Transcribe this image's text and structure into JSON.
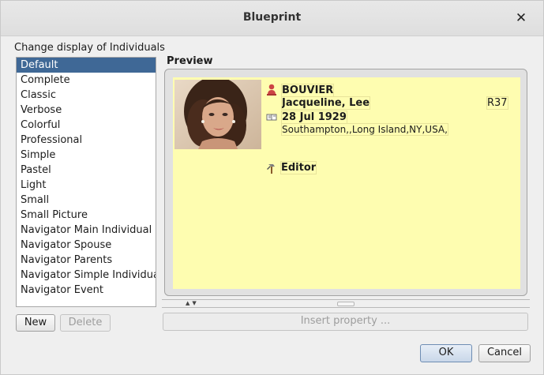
{
  "window": {
    "title": "Blueprint"
  },
  "left": {
    "label": "Change display of Individuals",
    "items": [
      "Default",
      "Complete",
      "Classic",
      "Verbose",
      "Colorful",
      "Professional",
      "Simple",
      "Pastel",
      "Light",
      "Small",
      "Small Picture",
      "Navigator Main Individual",
      "Navigator Spouse",
      "Navigator Parents",
      "Navigator Simple Individual",
      "Navigator Event"
    ],
    "selected": "Default",
    "new_label": "New",
    "delete_label": "Delete"
  },
  "preview": {
    "label": "Preview",
    "surname": "BOUVIER",
    "given": "Jacqueline, Lee",
    "id": "R37",
    "birth_date": "28 Jul 1929",
    "birth_place": "Southampton,,Long Island,NY,USA,",
    "occupation": "Editor",
    "icons": [
      "female-person-icon",
      "birth-icon",
      "occupation-tools-icon"
    ]
  },
  "insert_label": "Insert property ...",
  "ok_label": "OK",
  "cancel_label": "Cancel",
  "colors": {
    "selection": "#3f6896",
    "preview_bg": "#fefdb0"
  }
}
